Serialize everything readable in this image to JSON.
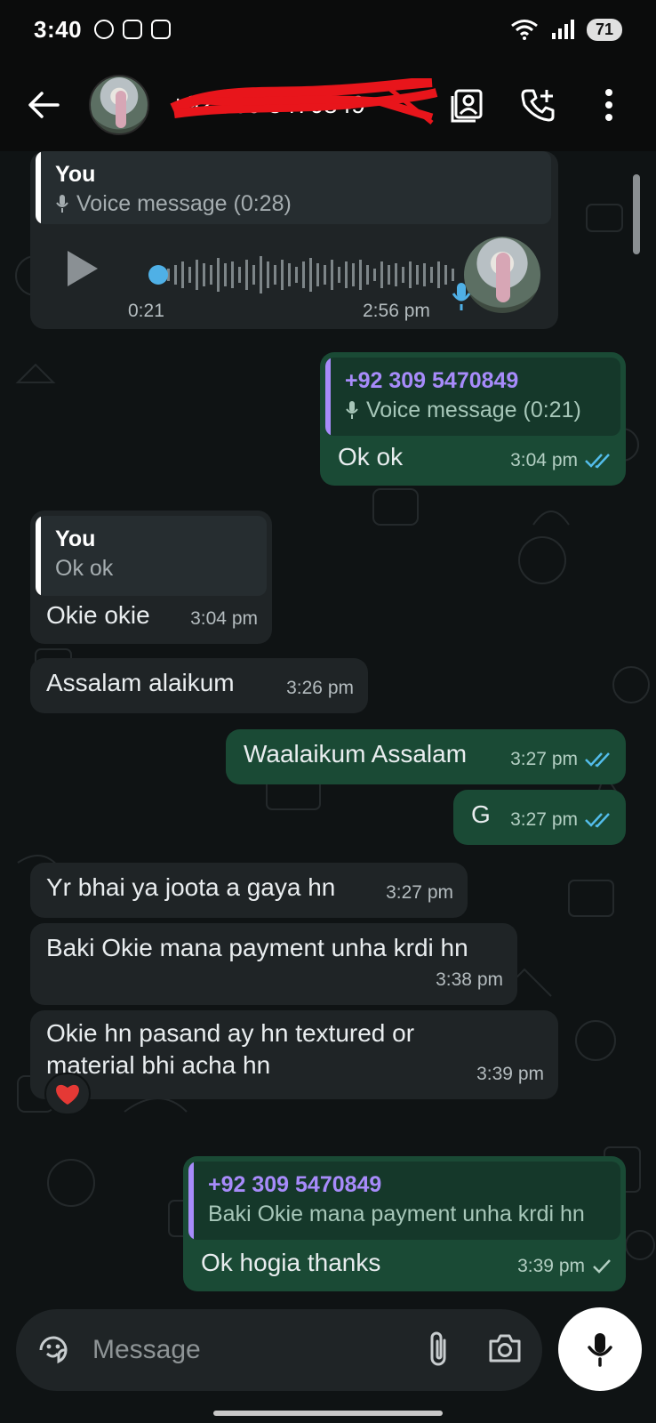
{
  "status_bar": {
    "time": "3:40",
    "battery": "71"
  },
  "app_bar": {
    "contact_name": "+92 309 5470849"
  },
  "messages": [
    {
      "id": "m1",
      "dir": "in",
      "quote_author": "You",
      "quote_text": "Voice message (0:28)",
      "voice_current": "0:21",
      "time": "2:56 pm"
    },
    {
      "id": "m2",
      "dir": "out",
      "quote_author": "+92 309 5470849",
      "quote_text": "Voice message (0:21)",
      "text": "Ok ok",
      "time": "3:04 pm",
      "status": "read"
    },
    {
      "id": "m3",
      "dir": "in",
      "quote_author": "You",
      "quote_text": "Ok ok",
      "text": "Okie okie",
      "time": "3:04 pm"
    },
    {
      "id": "m4",
      "dir": "in",
      "text": "Assalam alaikum",
      "time": "3:26 pm"
    },
    {
      "id": "m5",
      "dir": "out",
      "text": "Waalaikum Assalam",
      "time": "3:27 pm",
      "status": "read"
    },
    {
      "id": "m6",
      "dir": "out",
      "text": "G",
      "time": "3:27 pm",
      "status": "read"
    },
    {
      "id": "m7",
      "dir": "in",
      "text": "Yr bhai ya joota a gaya hn",
      "time": "3:27 pm"
    },
    {
      "id": "m8",
      "dir": "in",
      "text": "Baki Okie mana payment unha krdi hn",
      "time": "3:38 pm"
    },
    {
      "id": "m9",
      "dir": "in",
      "text_line1": "Okie hn pasand ay hn textured or",
      "text_line2": "material bhi acha hn",
      "time": "3:39 pm",
      "reaction": "❤️"
    },
    {
      "id": "m10",
      "dir": "out",
      "quote_author": "+92 309 5470849",
      "quote_text": "Baki Okie mana payment unha krdi hn",
      "text": "Ok hogia thanks",
      "time": "3:39 pm",
      "status": "sent"
    }
  ],
  "composer": {
    "placeholder": "Message"
  },
  "icons": {
    "back": "arrow-left-icon",
    "contact_card": "contact-card-icon",
    "add_call": "add-call-icon",
    "menu": "more-vert-icon",
    "emoji": "sticker-icon",
    "attach": "paperclip-icon",
    "camera": "camera-icon",
    "mic": "mic-icon"
  },
  "colors": {
    "incoming_bubble": "#1f2426",
    "outgoing_bubble": "#1a4a35",
    "read_ticks": "#53bdeb",
    "quote_them": "#a78bfa"
  }
}
